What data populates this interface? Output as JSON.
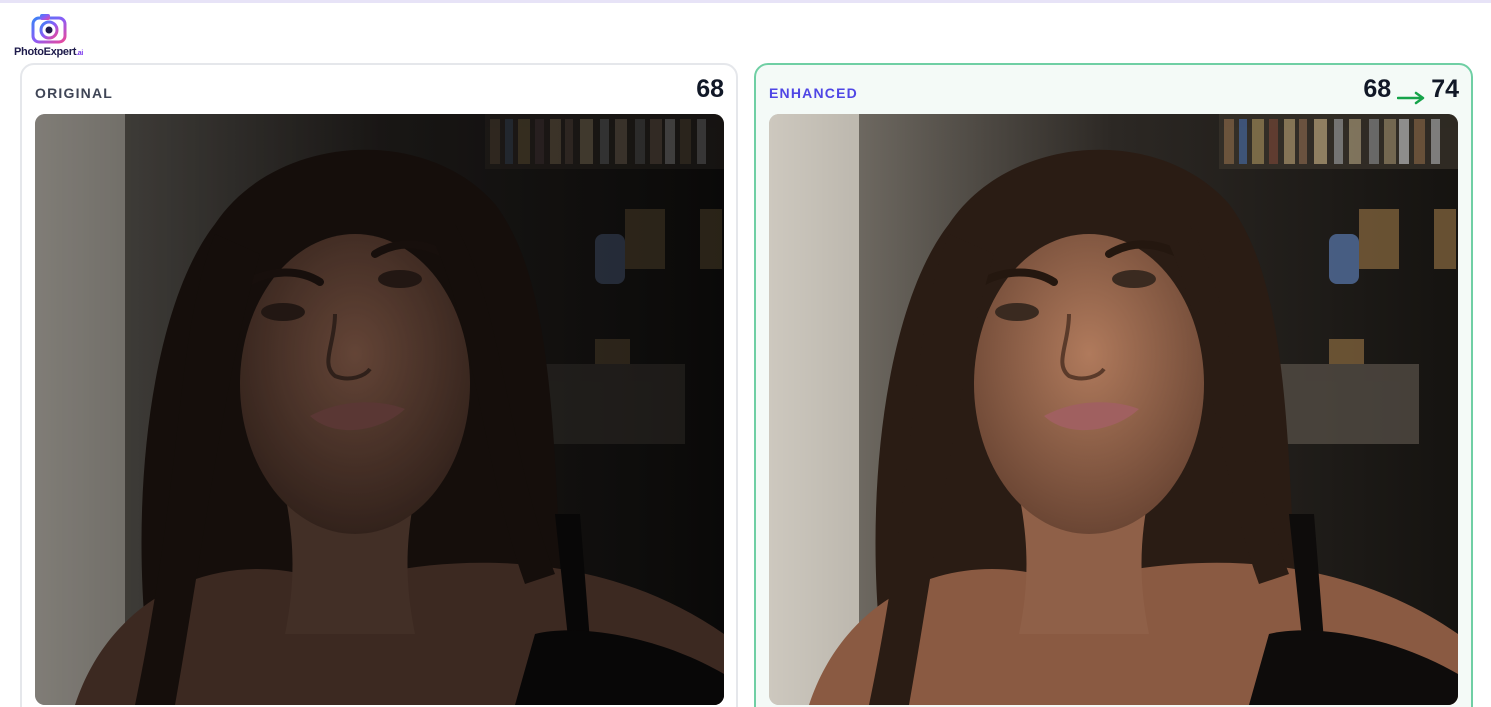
{
  "brand": {
    "name": "PhotoExpert",
    "suffix": ".ai",
    "accent": "#7c3aed",
    "logo_icon": "camera-lens-icon"
  },
  "panels": {
    "original": {
      "label": "ORIGINAL",
      "score": "68",
      "border_color": "#e5e7eb",
      "image_description_icon": "portrait-photo"
    },
    "enhanced": {
      "label": "ENHANCED",
      "score_before": "68",
      "score_after": "74",
      "arrow_icon": "arrow-right-icon",
      "border_color": "#6fcfa4",
      "label_color": "#4f46e5",
      "arrow_color": "#16a34a"
    }
  }
}
